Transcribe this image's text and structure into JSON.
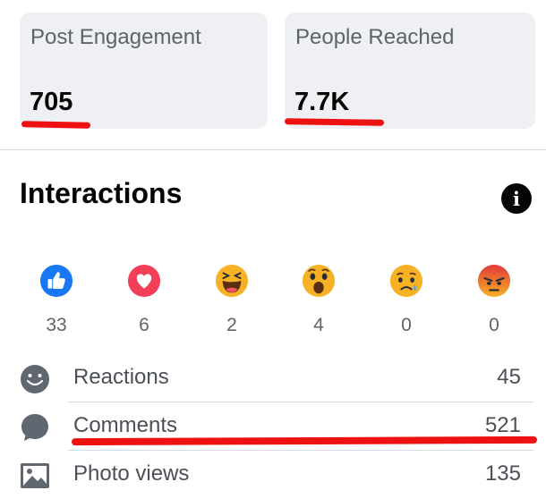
{
  "stats": {
    "post_engagement": {
      "label": "Post Engagement",
      "value": "705"
    },
    "people_reached": {
      "label": "People Reached",
      "value": "7.7K"
    }
  },
  "interactions": {
    "title": "Interactions",
    "info_icon": "info-icon",
    "reactions": [
      {
        "name": "like",
        "icon": "like-icon",
        "count": "33"
      },
      {
        "name": "love",
        "icon": "love-icon",
        "count": "6"
      },
      {
        "name": "haha",
        "icon": "haha-icon",
        "count": "2"
      },
      {
        "name": "wow",
        "icon": "wow-icon",
        "count": "4"
      },
      {
        "name": "sad",
        "icon": "sad-icon",
        "count": "0"
      },
      {
        "name": "angry",
        "icon": "angry-icon",
        "count": "0"
      }
    ],
    "metrics": [
      {
        "label": "Reactions",
        "value": "45",
        "icon": "smiley-icon"
      },
      {
        "label": "Comments",
        "value": "521",
        "icon": "comment-bubble-icon"
      },
      {
        "label": "Photo views",
        "value": "135",
        "icon": "photo-icon"
      }
    ]
  },
  "colors": {
    "card_background": "#eef0f3",
    "highlight_underline": "#ee1111",
    "like_blue": "#1877f2",
    "love_red": "#f33e58",
    "emoji_yellow": "#f7b125",
    "angry_orange": "#e9710f"
  }
}
